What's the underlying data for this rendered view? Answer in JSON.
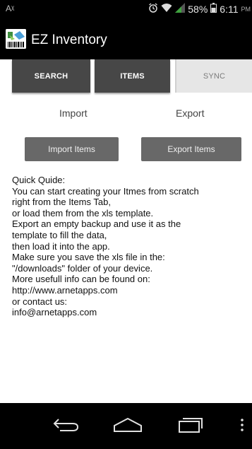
{
  "status_bar": {
    "left_icon": "Aᵡ",
    "battery": "58%",
    "time": "6:11",
    "time_suffix": "PM",
    "icons": [
      "alarm-icon",
      "wifi-icon",
      "signal-icon",
      "battery-icon"
    ]
  },
  "app": {
    "title": "EZ Inventory"
  },
  "tabs": [
    {
      "label": "SEARCH",
      "selected": false
    },
    {
      "label": "ITEMS",
      "selected": false
    },
    {
      "label": "SYNC",
      "selected": true
    }
  ],
  "sync": {
    "import_label": "Import",
    "export_label": "Export",
    "import_button": "Import Items",
    "export_button": "Export Items"
  },
  "guide_lines": [
    "Quick Quide:",
    "You can start creating your Itmes from scratch",
    "right from the Items Tab,",
    "or load them from the xls template.",
    "Export an empty backup and use it as the",
    "template to fill the data,",
    "then load it into the app.",
    "Make sure you save the xls file in the:",
    "\"/downloads\" folder of your device.",
    "More usefull info can be found on:",
    "http://www.arnetapps.com",
    "or contact us:",
    "info@arnetapps.com"
  ],
  "colors": {
    "tab_dark": "#474747",
    "tab_light": "#e6e6e6",
    "button": "#686868",
    "bar": "#000000"
  }
}
